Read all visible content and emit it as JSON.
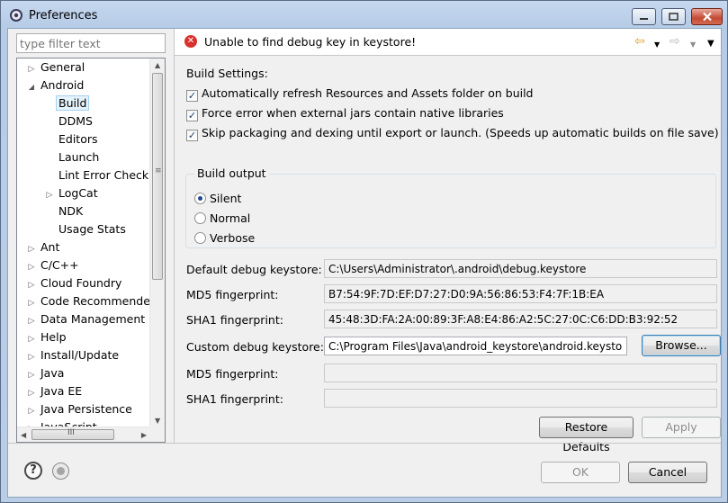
{
  "window": {
    "title": "Preferences",
    "icon": "preferences-gear-icon"
  },
  "sidebar": {
    "filter_placeholder": "type filter text",
    "items": [
      {
        "label": "General",
        "expander": "collapsed",
        "level": 0
      },
      {
        "label": "Android",
        "expander": "expanded",
        "level": 0
      },
      {
        "label": "Build",
        "expander": "none",
        "level": 1,
        "selected": true
      },
      {
        "label": "DDMS",
        "expander": "none",
        "level": 1
      },
      {
        "label": "Editors",
        "expander": "none",
        "level": 1
      },
      {
        "label": "Launch",
        "expander": "none",
        "level": 1
      },
      {
        "label": "Lint Error Checking",
        "expander": "none",
        "level": 1
      },
      {
        "label": "LogCat",
        "expander": "collapsed",
        "level": 1
      },
      {
        "label": "NDK",
        "expander": "none",
        "level": 1
      },
      {
        "label": "Usage Stats",
        "expander": "none",
        "level": 1
      },
      {
        "label": "Ant",
        "expander": "collapsed",
        "level": 0
      },
      {
        "label": "C/C++",
        "expander": "collapsed",
        "level": 0
      },
      {
        "label": "Cloud Foundry",
        "expander": "collapsed",
        "level": 0
      },
      {
        "label": "Code Recommenders",
        "expander": "collapsed",
        "level": 0
      },
      {
        "label": "Data Management",
        "expander": "collapsed",
        "level": 0
      },
      {
        "label": "Help",
        "expander": "collapsed",
        "level": 0
      },
      {
        "label": "Install/Update",
        "expander": "collapsed",
        "level": 0
      },
      {
        "label": "Java",
        "expander": "collapsed",
        "level": 0
      },
      {
        "label": "Java EE",
        "expander": "collapsed",
        "level": 0
      },
      {
        "label": "Java Persistence",
        "expander": "collapsed",
        "level": 0
      },
      {
        "label": "JavaScript",
        "expander": "collapsed",
        "level": 0
      }
    ],
    "hscroll_grip": "III"
  },
  "message": {
    "icon": "error-icon",
    "text": "Unable to find debug key in keystore!",
    "error_color": "#d9312c"
  },
  "build": {
    "section_title": "Build Settings:",
    "options": [
      {
        "label": "Automatically refresh Resources and Assets folder on build",
        "checked": true
      },
      {
        "label": "Force error when external jars contain native libraries",
        "checked": true
      },
      {
        "label": "Skip packaging and dexing until export or launch. (Speeds up automatic builds on file save)",
        "checked": true
      }
    ],
    "output_group": "Build output",
    "output_options": [
      {
        "label": "Silent",
        "selected": true
      },
      {
        "label": "Normal",
        "selected": false
      },
      {
        "label": "Verbose",
        "selected": false
      }
    ]
  },
  "keystore": {
    "default_label": "Default debug keystore:",
    "default_value": "C:\\Users\\Administrator\\.android\\debug.keystore",
    "md5_label": "MD5 fingerprint:",
    "md5_value": "B7:54:9F:7D:EF:D7:27:D0:9A:56:86:53:F4:7F:1B:EA",
    "sha1_label": "SHA1 fingerprint:",
    "sha1_value": "45:48:3D:FA:2A:00:89:3F:A8:E4:86:A2:5C:27:0C:C6:DD:B3:92:52",
    "custom_label": "Custom debug keystore:",
    "custom_value": "C:\\Program Files\\Java\\android_keystore\\android.keystore",
    "browse_label": "Browse...",
    "custom_md5_label": "MD5 fingerprint:",
    "custom_md5_value": "",
    "custom_sha1_label": "SHA1 fingerprint:",
    "custom_sha1_value": ""
  },
  "actions": {
    "restore_defaults": "Restore Defaults",
    "apply": "Apply",
    "ok": "OK",
    "cancel": "Cancel"
  }
}
